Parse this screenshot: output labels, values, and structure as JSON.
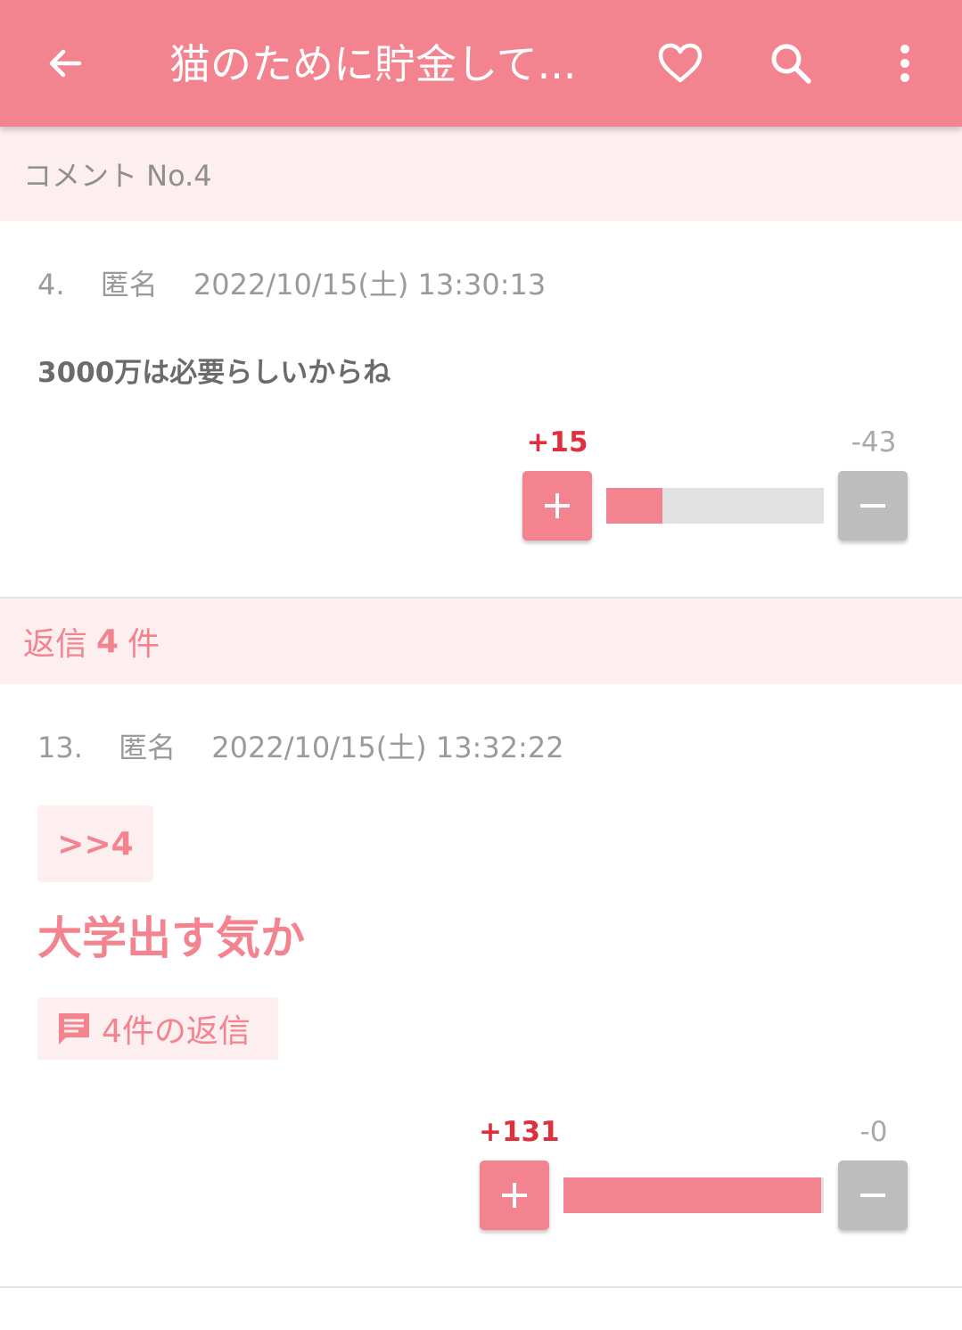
{
  "colors": {
    "accent": "#f3838e",
    "header_bg": "#fdeeef",
    "plus_count": "#e0303e",
    "minus_button": "#bdbdbd"
  },
  "appbar": {
    "title": "猫のために貯金して...",
    "icons": [
      "arrow-left-icon",
      "heart-outline-icon",
      "search-icon",
      "more-vert-icon"
    ]
  },
  "comment_header": {
    "label": "コメント No.4"
  },
  "comment": {
    "number": "4.",
    "author": "匿名",
    "timestamp": "2022/10/15(土) 13:30:13",
    "body": "3000万は必要らしいからね",
    "votes": {
      "plus": "+15",
      "minus": "-43",
      "plus_ratio": 0.26
    }
  },
  "reply_header": {
    "prefix": "返信",
    "count": "4",
    "suffix": "件"
  },
  "reply": {
    "number": "13.",
    "author": "匿名",
    "timestamp": "2022/10/15(土) 13:32:22",
    "anchor": ">>4",
    "body": "大学出す気か",
    "replies_label": "4件の返信",
    "votes": {
      "plus": "+131",
      "minus": "-0",
      "plus_ratio": 0.99
    }
  }
}
